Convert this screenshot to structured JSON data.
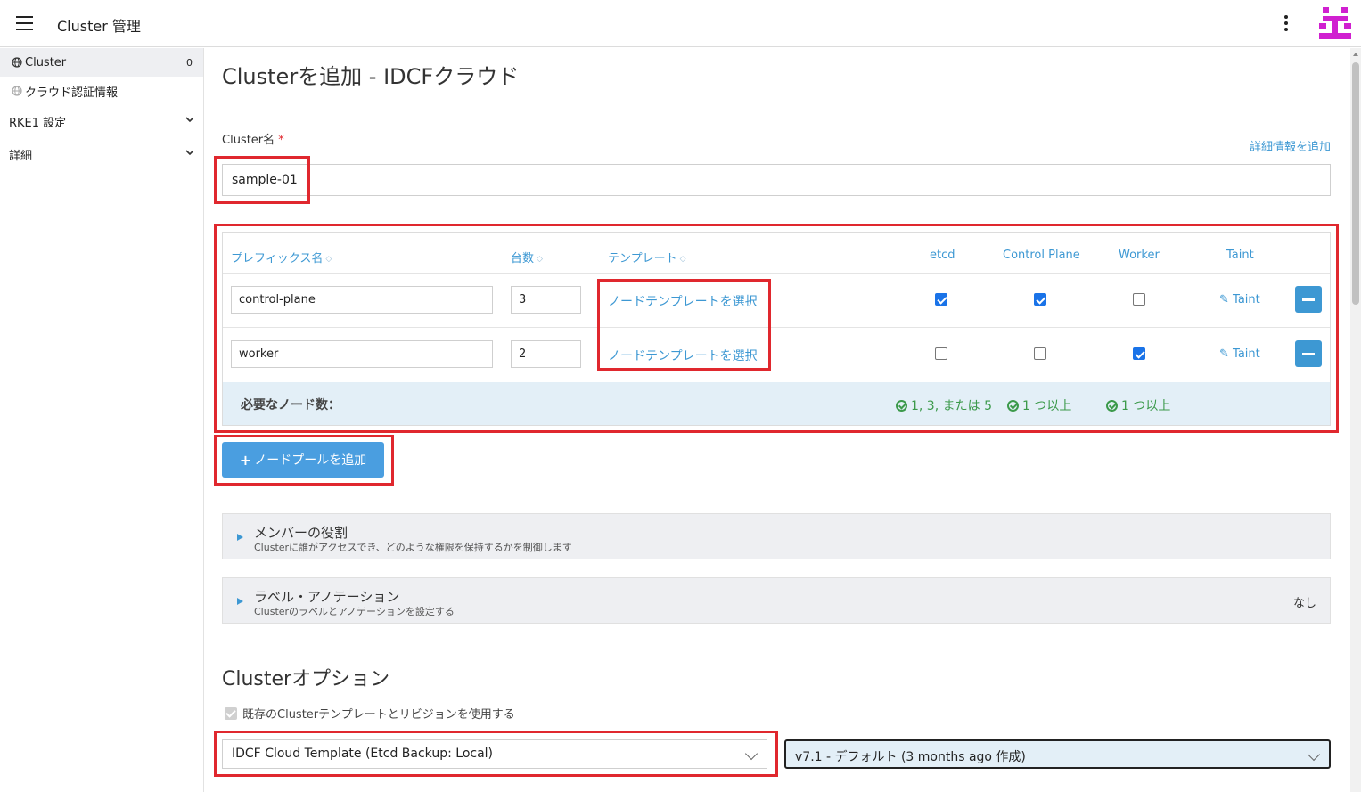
{
  "header": {
    "title": "Cluster 管理"
  },
  "sidebar": {
    "items": [
      {
        "label": "Cluster",
        "count": "0"
      },
      {
        "label": "クラウド認証情報"
      }
    ],
    "groups": [
      {
        "label": "RKE1 設定"
      },
      {
        "label": "詳細"
      }
    ]
  },
  "page": {
    "title": "Clusterを追加 - IDCFクラウド",
    "name_label": "Cluster名",
    "required_mark": "*",
    "add_detail_link": "詳細情報を追加",
    "name_value": "sample-01"
  },
  "node_pools": {
    "headers": {
      "prefix": "プレフィックス名",
      "count": "台数",
      "template": "テンプレート",
      "etcd": "etcd",
      "control_plane": "Control Plane",
      "worker": "Worker",
      "taint": "Taint"
    },
    "rows": [
      {
        "prefix": "control-plane",
        "count": "3",
        "template": "ノードテンプレートを選択",
        "etcd": true,
        "control_plane": true,
        "worker": false,
        "taint": "Taint"
      },
      {
        "prefix": "worker",
        "count": "2",
        "template": "ノードテンプレートを選択",
        "etcd": false,
        "control_plane": false,
        "worker": true,
        "taint": "Taint"
      }
    ],
    "summary": {
      "label": "必要なノード数：",
      "etcd": "1, 3, または 5",
      "control_plane": "1 つ以上",
      "worker": "1 つ以上"
    },
    "add_button": "ノードプールを追加"
  },
  "accordions": [
    {
      "title": "メンバーの役割",
      "subtitle": "Clusterに誰がアクセスでき、どのような権限を保持するかを制御します",
      "right": ""
    },
    {
      "title": "ラベル・アノテーション",
      "subtitle": "Clusterのラベルとアノテーションを設定する",
      "right": "なし"
    }
  ],
  "options": {
    "title": "Clusterオプション",
    "use_template_label": "既存のClusterテンプレートとリビジョンを使用する",
    "template_select": "IDCF Cloud Template (Etcd Backup: Local)",
    "revision_select": "v7.1 - デフォルト (3 months ago 作成)"
  },
  "colors": {
    "accent": "#3d98d3",
    "highlight": "#e0282e",
    "success": "#3c9a4b"
  }
}
